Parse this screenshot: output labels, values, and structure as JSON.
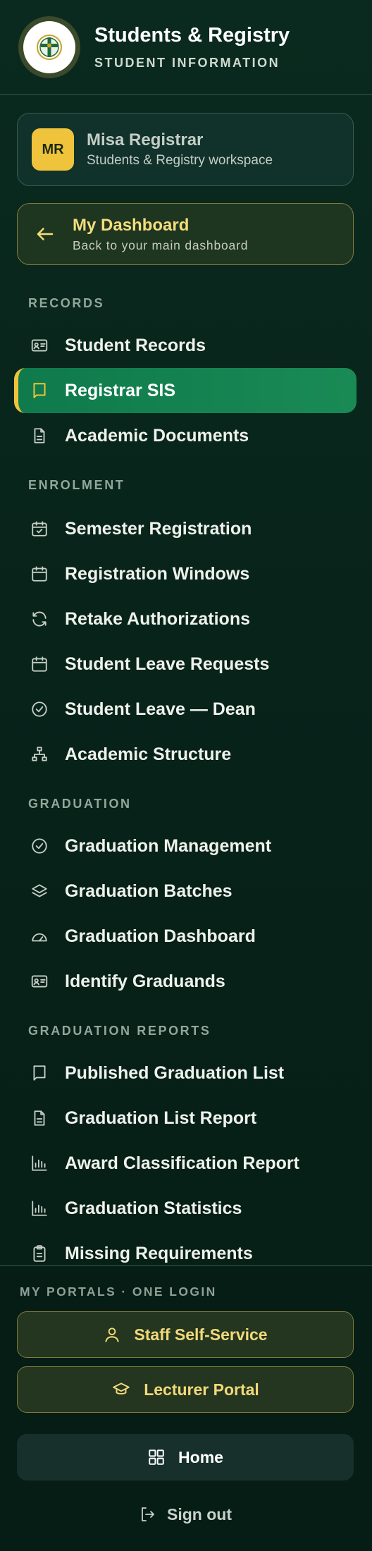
{
  "header": {
    "title": "Students & Registry",
    "subtitle": "STUDENT INFORMATION",
    "logo_icon": "university-crest-icon"
  },
  "user": {
    "initials": "MR",
    "name": "Misa Registrar",
    "workspace": "Students & Registry workspace"
  },
  "dashboard": {
    "title": "My Dashboard",
    "subtitle": "Back to your main dashboard"
  },
  "sections": {
    "records": "RECORDS",
    "enrolment": "ENROLMENT",
    "graduation": "GRADUATION",
    "graduation_reports": "GRADUATION REPORTS"
  },
  "nav": {
    "student_records": "Student Records",
    "registrar_sis": "Registrar SIS",
    "academic_documents": "Academic Documents",
    "semester_registration": "Semester Registration",
    "registration_windows": "Registration Windows",
    "retake_authorizations": "Retake Authorizations",
    "student_leave_requests": "Student Leave Requests",
    "student_leave_dean": "Student Leave — Dean",
    "academic_structure": "Academic Structure",
    "graduation_management": "Graduation Management",
    "graduation_batches": "Graduation Batches",
    "graduation_dashboard": "Graduation Dashboard",
    "identify_graduands": "Identify Graduands",
    "published_graduation_list": "Published Graduation List",
    "graduation_list_report": "Graduation List Report",
    "award_classification_report": "Award Classification Report",
    "graduation_statistics": "Graduation Statistics",
    "missing_requirements": "Missing Requirements"
  },
  "portals": {
    "label": "MY PORTALS · ONE LOGIN",
    "staff": "Staff Self-Service",
    "lecturer": "Lecturer Portal"
  },
  "footer": {
    "home": "Home",
    "signout": "Sign out"
  },
  "colors": {
    "accent_gold": "#f0c33c",
    "active_green": "#0f7a4c",
    "background": "#08241b"
  }
}
